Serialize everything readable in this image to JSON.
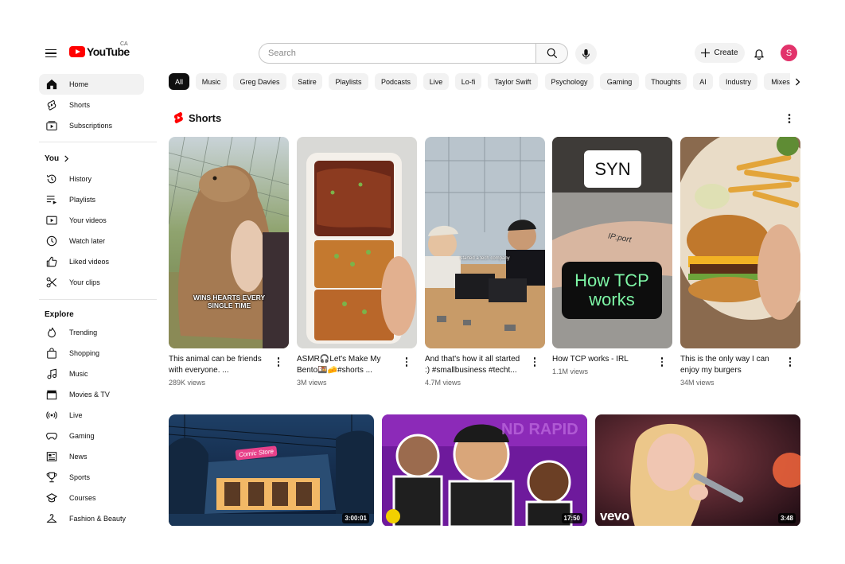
{
  "header": {
    "logo_text": "YouTube",
    "region": "CA",
    "search_placeholder": "Search",
    "create_label": "Create",
    "avatar_letter": "S"
  },
  "sidebar": {
    "main": [
      {
        "label": "Home",
        "icon": "home-icon",
        "active": true
      },
      {
        "label": "Shorts",
        "icon": "shorts-icon"
      },
      {
        "label": "Subscriptions",
        "icon": "subscriptions-icon"
      }
    ],
    "you_title": "You",
    "you": [
      {
        "label": "History",
        "icon": "history-icon"
      },
      {
        "label": "Playlists",
        "icon": "playlists-icon"
      },
      {
        "label": "Your videos",
        "icon": "your-videos-icon"
      },
      {
        "label": "Watch later",
        "icon": "clock-icon"
      },
      {
        "label": "Liked videos",
        "icon": "thumbs-up-icon"
      },
      {
        "label": "Your clips",
        "icon": "scissors-icon"
      }
    ],
    "explore_title": "Explore",
    "explore": [
      {
        "label": "Trending",
        "icon": "trending-icon"
      },
      {
        "label": "Shopping",
        "icon": "shopping-bag-icon"
      },
      {
        "label": "Music",
        "icon": "music-note-icon"
      },
      {
        "label": "Movies & TV",
        "icon": "clapperboard-icon"
      },
      {
        "label": "Live",
        "icon": "live-icon"
      },
      {
        "label": "Gaming",
        "icon": "gamepad-icon"
      },
      {
        "label": "News",
        "icon": "newspaper-icon"
      },
      {
        "label": "Sports",
        "icon": "trophy-icon"
      },
      {
        "label": "Courses",
        "icon": "graduation-cap-icon"
      },
      {
        "label": "Fashion & Beauty",
        "icon": "hanger-icon"
      }
    ]
  },
  "chips": [
    "All",
    "Music",
    "Greg Davies",
    "Satire",
    "Playlists",
    "Podcasts",
    "Live",
    "Lo-fi",
    "Taylor Swift",
    "Psychology",
    "Gaming",
    "Thoughts",
    "AI",
    "Industry",
    "Mixes"
  ],
  "shorts": {
    "title": "Shorts",
    "items": [
      {
        "title": "This animal can be friends with everyone. ...",
        "views": "289K views",
        "overlay": "WINS HEARTS EVERY SINGLE TIME"
      },
      {
        "title": "ASMR🎧Let's Make My Bento🍱🧀#shorts ...",
        "views": "3M views",
        "overlay": ""
      },
      {
        "title": "And that's how it all started :) #smallbusiness #techt...",
        "views": "4.7M views",
        "overlay": "started a tech company"
      },
      {
        "title": "How TCP works - IRL",
        "views": "1.1M views",
        "overlay": "SYN",
        "overlay2": "How TCP works",
        "hand_text": "IP:port"
      },
      {
        "title": "This is the only way I can enjoy my burgers",
        "views": "34M views",
        "overlay": ""
      }
    ]
  },
  "videos": [
    {
      "duration": "3:00:01",
      "sign": "Comic Store"
    },
    {
      "duration": "17:50",
      "sign": "ND RAPID"
    },
    {
      "duration": "3:48",
      "brand": "vevo"
    }
  ],
  "colors": {
    "brand_red": "#ff0000",
    "avatar": "#e2336b",
    "chip_bg": "#f2f2f2",
    "tcp_green": "#7df5a5"
  }
}
